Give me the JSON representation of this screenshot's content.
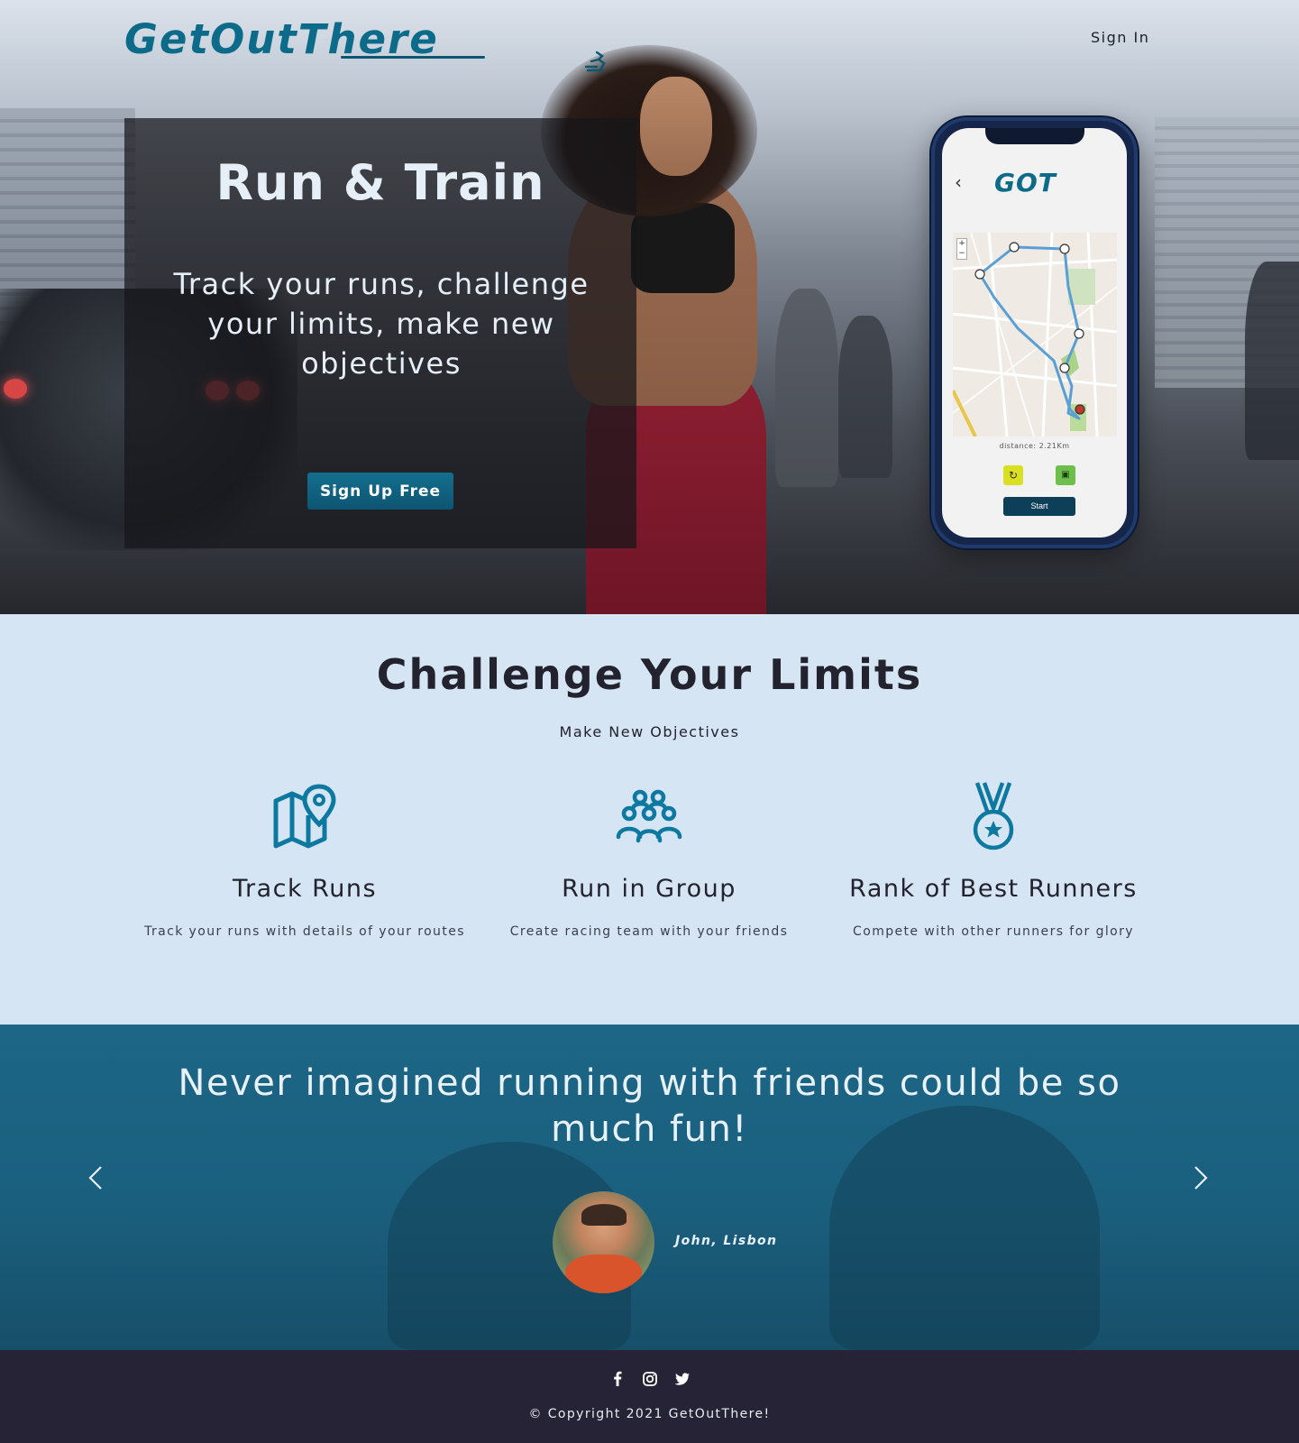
{
  "header": {
    "logo_text": "GetOutThere",
    "signin_label": "Sign In"
  },
  "hero": {
    "title": "Run & Train",
    "subtitle": "Track your runs, challenge your limits, make new objectives",
    "cta_label": "Sign Up Free"
  },
  "phone": {
    "logo_text": "GOT",
    "distance_label": "distance: 2.21Km",
    "start_label": "Start"
  },
  "features": {
    "title": "Challenge Your Limits",
    "subtitle": "Make New Objectives",
    "items": [
      {
        "icon": "map-pin-icon",
        "title": "Track Runs",
        "description": "Track your runs with details of your routes"
      },
      {
        "icon": "group-icon",
        "title": "Run in Group",
        "description": "Create racing team with your friends"
      },
      {
        "icon": "medal-icon",
        "title": "Rank of Best Runners",
        "description": "Compete with other runners for glory"
      }
    ]
  },
  "testimonial": {
    "quote": "Never imagined running with friends could be so much fun!",
    "author": "John, Lisbon",
    "prev_icon": "chevron-left-icon",
    "next_icon": "chevron-right-icon"
  },
  "footer": {
    "social": [
      "facebook-icon",
      "instagram-icon",
      "twitter-icon"
    ],
    "copyright": "© Copyright 2021 GetOutThere!"
  },
  "colors": {
    "brand": "#0c6b89",
    "button": "#0d5572",
    "features_bg": "#d6e5f3",
    "testimonial_bg": "#1a5f7e",
    "footer_bg": "#252335",
    "text_dark": "#23222f"
  }
}
